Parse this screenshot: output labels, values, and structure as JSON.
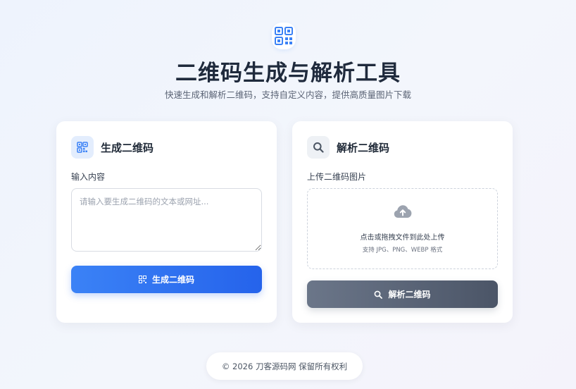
{
  "header": {
    "logo_icon": "qr-code-icon",
    "title": "二维码生成与解析工具",
    "subtitle": "快速生成和解析二维码，支持自定义内容，提供高质量图片下载"
  },
  "generate_card": {
    "icon": "qr-code-icon",
    "title": "生成二维码",
    "input_label": "输入内容",
    "input_value": "",
    "input_placeholder": "请输入要生成二维码的文本或网址...",
    "button_icon": "qr-code-icon",
    "button_label": "生成二维码"
  },
  "parse_card": {
    "icon": "search-icon",
    "title": "解析二维码",
    "upload_label": "上传二维码图片",
    "upload_icon": "cloud-upload-icon",
    "upload_text": "点击或拖拽文件到此处上传",
    "upload_hint": "支持 JPG、PNG、WEBP 格式",
    "button_icon": "search-icon",
    "button_label": "解析二维码"
  },
  "footer": {
    "text": "© 2026 刀客源码网 保留所有权利"
  },
  "colors": {
    "accent": "#3b82f6",
    "accent_dark": "#2563eb",
    "parse_button": "#5b6577",
    "title": "#1f2a3c"
  }
}
